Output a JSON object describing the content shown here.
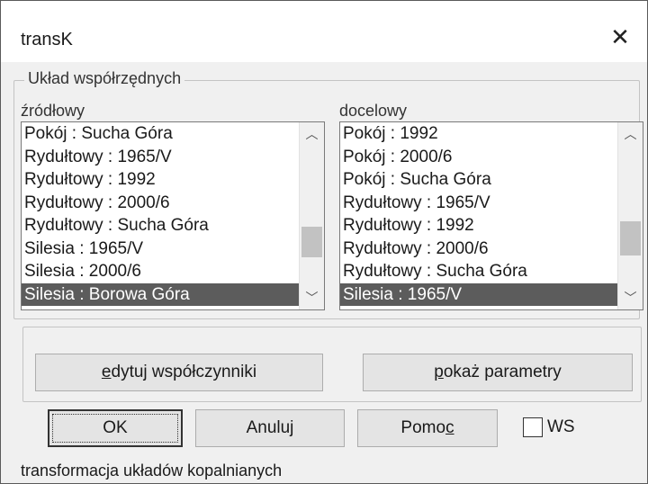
{
  "window": {
    "title": "transK",
    "close_icon": "close-icon",
    "close_glyph": "✕"
  },
  "coords_group": {
    "legend": "Układ współrzędnych",
    "source": {
      "label": "źródłowy",
      "items": [
        "Pokój : Sucha Góra",
        "Rydułtowy : 1965/V",
        "Rydułtowy : 1992",
        "Rydułtowy : 2000/6",
        "Rydułtowy : Sucha Góra",
        "Silesia : 1965/V",
        "Silesia : 2000/6",
        "Silesia : Borowa Góra"
      ],
      "selected": "Silesia : Borowa Góra",
      "scroll_position": 0.55
    },
    "target": {
      "label": "docelowy",
      "items": [
        "Pokój : 1992",
        "Pokój : 2000/6",
        "Pokój : Sucha Góra",
        "Rydułtowy : 1965/V",
        "Rydułtowy : 1992",
        "Rydułtowy : 2000/6",
        "Rydułtowy : Sucha Góra",
        "Silesia : 1965/V"
      ],
      "selected": "Silesia : 1965/V",
      "scroll_position": 0.55
    },
    "scroll_up_glyph": "︿",
    "scroll_down_glyph": "﹀"
  },
  "actions": {
    "edit_coefficients": {
      "pre": "",
      "accel": "e",
      "post": "dytuj współczynniki"
    },
    "show_parameters": {
      "pre": "",
      "accel": "p",
      "post": "okaż parametry"
    }
  },
  "buttons": {
    "ok": "OK",
    "cancel": "Anuluj",
    "help": {
      "pre": "Pomo",
      "accel": "c",
      "post": ""
    }
  },
  "ws_checkbox": {
    "label": "WS",
    "checked": false
  },
  "status": "transformacja układów kopalnianych"
}
